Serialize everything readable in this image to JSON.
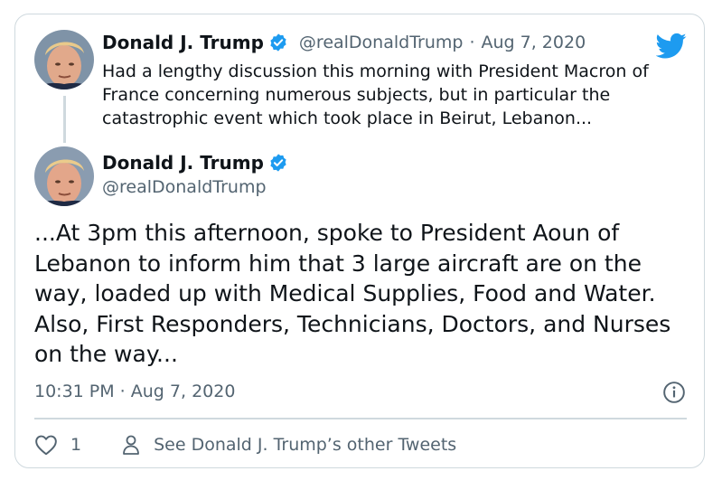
{
  "colors": {
    "brand_blue": "#1d9bf0",
    "text_primary": "#0f1419",
    "text_secondary": "#536471",
    "border": "#cfd9de"
  },
  "quoted_tweet": {
    "author_name": "Donald J. Trump",
    "handle": "@realDonaldTrump",
    "separator": "·",
    "date": "Aug 7, 2020",
    "text": "Had a lengthy discussion this morning with President Macron of France concerning numerous subjects, but in particular the catastrophic event which took place in Beirut, Lebanon..."
  },
  "main_tweet": {
    "author_name": "Donald J. Trump",
    "handle": "@realDonaldTrump",
    "text": "...At 3pm this afternoon, spoke to President Aoun of Lebanon to inform him that 3 large aircraft are on the way, loaded up with Medical Supplies, Food and Water. Also, First Responders, Technicians, Doctors, and Nurses on the way...",
    "timestamp": "10:31 PM · Aug 7, 2020"
  },
  "actions": {
    "like_count": "1",
    "other_tweets_label": "See Donald J. Trump’s other Tweets"
  },
  "icons": {
    "brand": "twitter-bird-icon",
    "verified": "verified-badge-icon",
    "info": "info-icon",
    "like": "heart-icon",
    "profile": "person-icon"
  }
}
